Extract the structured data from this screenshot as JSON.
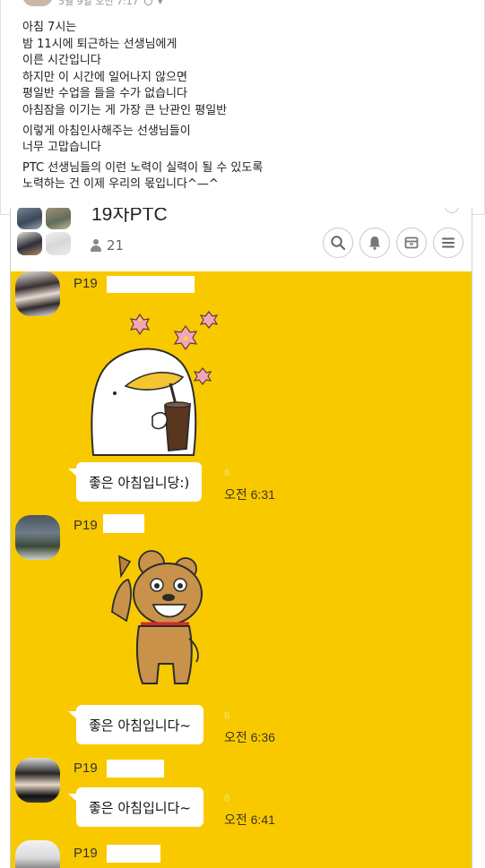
{
  "post": {
    "date_text": "5월 9일 오전 7:17",
    "paragraphs": [
      [
        "아침 7시는",
        "밤 11시에 퇴근하는 선생님에게",
        "이른 시간입니다",
        "하지만 이 시간에 일어나지 않으면",
        "평일반 수업을 들을 수가 없습니다",
        "아침잠을 이기는 게 가장 큰 난관인 평일반"
      ],
      [
        "이렇게 아침인사해주는 선생님들이",
        "너무 고맙습니다"
      ],
      [
        "PTC 선생님들의 이런 노력이 실력이 될 수 있도록",
        "노력하는 건 이제 우리의 몫입니다^—^"
      ]
    ]
  },
  "chatroom": {
    "title": "19차PTC",
    "member_count": "21",
    "header_icons": [
      "search-icon",
      "notification-bell-icon",
      "drawer-icon",
      "menu-icon"
    ]
  },
  "messages": [
    {
      "sender": "P19",
      "sticker": "ryan-coffee-sticker",
      "text": "좋은 아침입니당:)",
      "unread": "6",
      "time": "오전 6:31"
    },
    {
      "sender": "P19",
      "sticker": "frodo-dog-sticker",
      "text": "좋은 아침입니다~",
      "unread": "8",
      "time": "오전 6:36"
    },
    {
      "sender": "P19",
      "text": "좋은 아침입니다~",
      "unread": "8",
      "time": "오전 6:41"
    },
    {
      "sender": "P19"
    }
  ],
  "colors": {
    "chat_background": "#f9c900",
    "bubble": "#ffffff",
    "unread": "#f6e27a"
  }
}
